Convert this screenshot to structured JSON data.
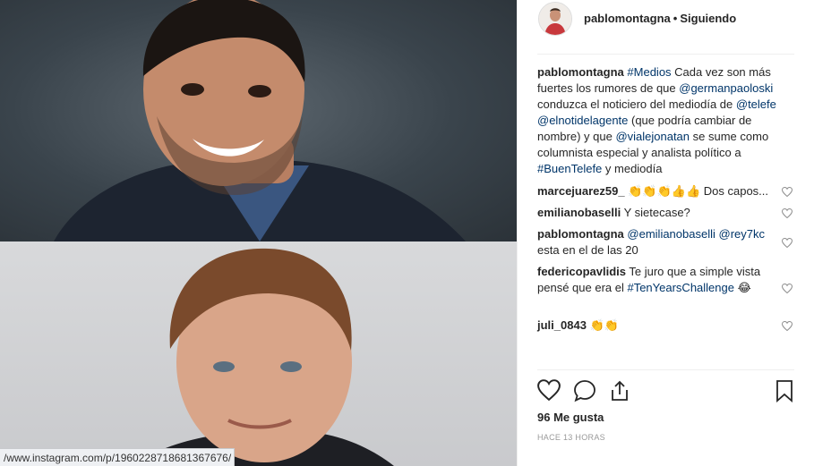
{
  "photo": {
    "top_person": "smiling man with dark hair and stubble",
    "bottom_person": "man with reddish hair in a suit",
    "url": "/www.instagram.com/p/1960228718681367676/"
  },
  "header": {
    "username": "pablomontagna",
    "separator": "•",
    "follow_status": "Siguiendo"
  },
  "caption": {
    "user": "pablomontagna",
    "parts": [
      {
        "t": "#Medios",
        "link": true
      },
      {
        "t": " Cada vez son más fuertes los rumores de que ",
        "link": false
      },
      {
        "t": "@germanpaoloski",
        "link": true
      },
      {
        "t": " conduzca el noticiero del mediodía de ",
        "link": false
      },
      {
        "t": "@telefe",
        "link": true
      },
      {
        "t": " ",
        "link": false
      },
      {
        "t": "@elnotidelagente",
        "link": true
      },
      {
        "t": " (que podría cambiar de nombre) y que ",
        "link": false
      },
      {
        "t": "@vialejonatan",
        "link": true
      },
      {
        "t": " se sume como columnista especial y analista político a ",
        "link": false
      },
      {
        "t": "#BuenTelefe",
        "link": true
      },
      {
        "t": " y mediodía",
        "link": false
      }
    ]
  },
  "comments": [
    {
      "user": "marcejuarez59_",
      "text": "👏👏👏👍👍 Dos capos...",
      "mention": "",
      "text2": ""
    },
    {
      "user": "emilianobaselli",
      "text": "Y sietecase?",
      "mention": "",
      "text2": ""
    },
    {
      "user": "pablomontagna",
      "mention": "@emilianobaselli",
      "mention2": "@rey7kc",
      "text": " esta en el de las 20"
    },
    {
      "user": "federicopavlidis",
      "text": "Te juro que a simple vista pensé que era el ",
      "mention": "#TenYearsChallenge",
      "text2": " 😂"
    },
    {
      "user": "juli_0843",
      "text": "👏👏",
      "mention": "",
      "text2": ""
    }
  ],
  "actions": {
    "like_icon": "heart-icon",
    "comment_icon": "comment-icon",
    "share_icon": "share-icon",
    "save_icon": "bookmark-icon",
    "likes": "96 Me gusta",
    "timestamp": "HACE 13 HORAS"
  }
}
